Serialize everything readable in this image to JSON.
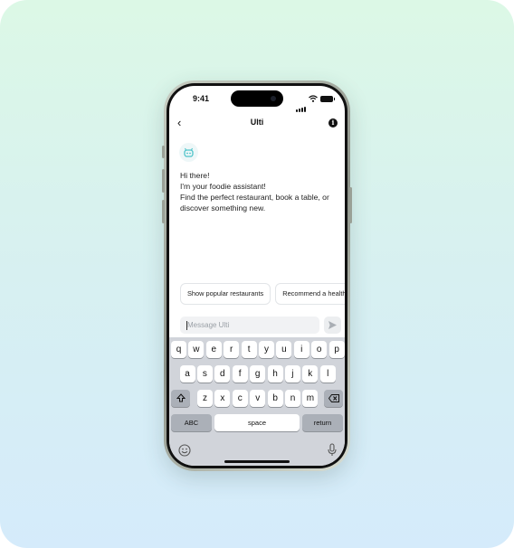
{
  "status_bar": {
    "time": "9:41"
  },
  "header": {
    "title": "Ulti",
    "back_icon": "chevron-left-icon",
    "info_icon": "info-circle-icon"
  },
  "chat": {
    "assistant_icon": "robot-icon",
    "message_lines": [
      "Hi there!",
      "I'm your foodie assistant!",
      "Find the perfect restaurant, book a table, or",
      "discover something new."
    ]
  },
  "suggestions": [
    "Show popular restaurants",
    "Recommend a healthy"
  ],
  "composer": {
    "placeholder": "Message Ulti",
    "value": "",
    "send_icon": "send-icon"
  },
  "keyboard": {
    "row1": [
      "q",
      "w",
      "e",
      "r",
      "t",
      "y",
      "u",
      "i",
      "o",
      "p"
    ],
    "row2": [
      "a",
      "s",
      "d",
      "f",
      "g",
      "h",
      "j",
      "k",
      "l"
    ],
    "row3": [
      "z",
      "x",
      "c",
      "v",
      "b",
      "n",
      "m"
    ],
    "shift_icon": "shift-icon",
    "delete_icon": "delete-backspace-icon",
    "abc_label": "ABC",
    "space_label": "space",
    "return_label": "return",
    "emoji_icon": "emoji-icon",
    "mic_icon": "microphone-icon"
  },
  "colors": {
    "accent": "#4ec3c9",
    "background_top": "#dcf8e6",
    "background_bottom": "#d5ebfb"
  }
}
